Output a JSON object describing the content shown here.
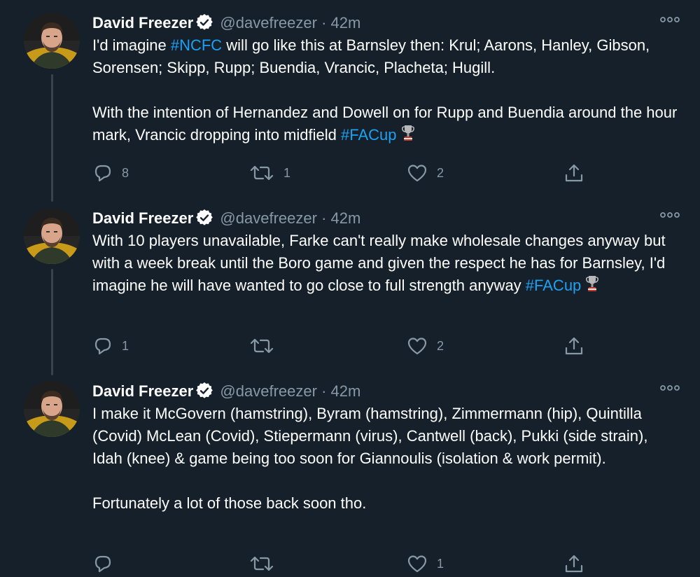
{
  "colors": {
    "background": "#15202b",
    "text": "#ffffff",
    "secondary": "#8899a6",
    "hashtag": "#1da1f2",
    "verified": "#ffffff",
    "thread_line": "#38444d"
  },
  "tweets": [
    {
      "author": {
        "name": "David Freezer",
        "handle": "@davefreezer",
        "verified": true
      },
      "separator": "·",
      "time": "42m",
      "more_icon": "more-dots-icon",
      "text": {
        "p1_before": "I'd imagine ",
        "p1_tag": "#NCFC",
        "p1_after": " will go like this at Barnsley then: Krul; Aarons, Hanley, Gibson, Sorensen; Skipp, Rupp; Buendia, Vrancic, Placheta; Hugill.",
        "p2_before": "With the intention of Hernandez and Dowell on for Rupp and Buendia around the hour mark, Vrancic dropping into midfield ",
        "p2_tag": "#FACup"
      },
      "actions": {
        "reply": "8",
        "retweet": "1",
        "like": "2"
      }
    },
    {
      "author": {
        "name": "David Freezer",
        "handle": "@davefreezer",
        "verified": true
      },
      "separator": "·",
      "time": "42m",
      "more_icon": "more-dots-icon",
      "text": {
        "p1_before": "With 10 players unavailable, Farke can't really make wholesale changes anyway but with a week break until the Boro game and given the respect he has for Barnsley, I'd imagine he will have wanted to go close to full strength anyway ",
        "p1_tag": "#FACup"
      },
      "actions": {
        "reply": "1",
        "retweet": "",
        "like": "2"
      }
    },
    {
      "author": {
        "name": "David Freezer",
        "handle": "@davefreezer",
        "verified": true
      },
      "separator": "·",
      "time": "42m",
      "more_icon": "more-dots-icon",
      "text": {
        "p1": "I make it McGovern (hamstring), Byram (hamstring), Zimmermann (hip), Quintilla (Covid) McLean (Covid), Stiepermann (virus), Cantwell (back), Pukki (side strain), Idah (knee) & game being too soon for Giannoulis (isolation & work permit).",
        "p2": "Fortunately a lot of those back soon tho."
      },
      "actions": {
        "reply": "",
        "retweet": "",
        "like": "1"
      }
    }
  ]
}
